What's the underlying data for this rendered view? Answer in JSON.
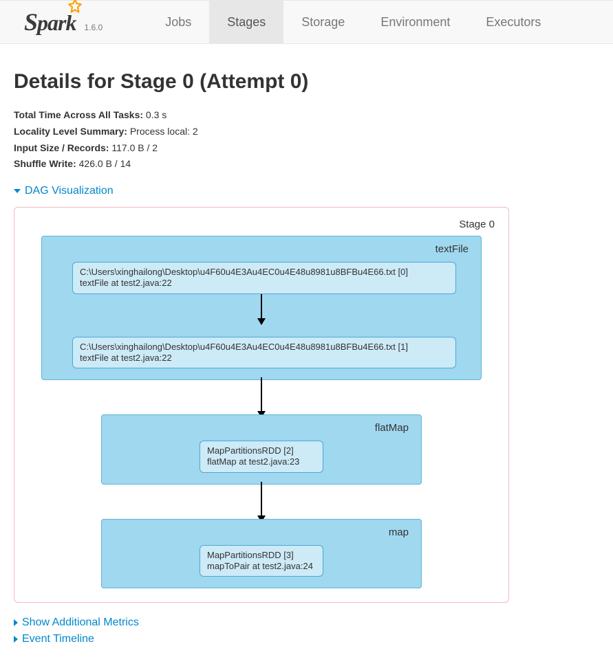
{
  "brand": {
    "name": "Spark",
    "version": "1.6.0"
  },
  "nav": {
    "jobs": "Jobs",
    "stages": "Stages",
    "storage": "Storage",
    "environment": "Environment",
    "executors": "Executors"
  },
  "page": {
    "title": "Details for Stage 0 (Attempt 0)"
  },
  "metrics": {
    "total_time_label": "Total Time Across All Tasks:",
    "total_time_value": "0.3 s",
    "locality_label": "Locality Level Summary:",
    "locality_value": "Process local: 2",
    "input_label": "Input Size / Records:",
    "input_value": "117.0 B / 2",
    "shuffle_label": "Shuffle Write:",
    "shuffle_value": "426.0 B / 14"
  },
  "toggles": {
    "dag": "DAG Visualization",
    "additional_metrics": "Show Additional Metrics",
    "event_timeline": "Event Timeline"
  },
  "dag": {
    "stage_label": "Stage 0",
    "clusters": {
      "textFile": {
        "label": "textFile",
        "nodes": [
          {
            "line1": "C:\\Users\\xinghailong\\Desktop\\u4F60u4E3Au4EC0u4E48u8981u8BFBu4E66.txt [0]",
            "line2": "textFile at test2.java:22"
          },
          {
            "line1": "C:\\Users\\xinghailong\\Desktop\\u4F60u4E3Au4EC0u4E48u8981u8BFBu4E66.txt [1]",
            "line2": "textFile at test2.java:22"
          }
        ]
      },
      "flatMap": {
        "label": "flatMap",
        "nodes": [
          {
            "line1": "MapPartitionsRDD [2]",
            "line2": "flatMap at test2.java:23"
          }
        ]
      },
      "map": {
        "label": "map",
        "nodes": [
          {
            "line1": "MapPartitionsRDD [3]",
            "line2": "mapToPair at test2.java:24"
          }
        ]
      }
    }
  }
}
